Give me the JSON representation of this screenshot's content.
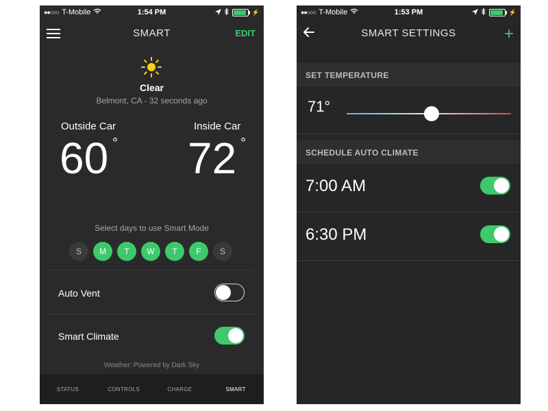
{
  "left": {
    "status": {
      "carrier": "T-Mobile",
      "time": "1:54 PM"
    },
    "nav": {
      "title": "SMART",
      "edit": "EDIT"
    },
    "weather": {
      "condition": "Clear",
      "location": "Belmont, CA - 32 seconds ago",
      "icon": "sun-icon"
    },
    "outside": {
      "label": "Outside Car",
      "value": "60"
    },
    "inside": {
      "label": "Inside Car",
      "value": "72"
    },
    "days_caption": "Select days to use Smart Mode",
    "days": [
      {
        "letter": "S",
        "on": false
      },
      {
        "letter": "M",
        "on": true
      },
      {
        "letter": "T",
        "on": true
      },
      {
        "letter": "W",
        "on": true
      },
      {
        "letter": "T",
        "on": true
      },
      {
        "letter": "F",
        "on": true
      },
      {
        "letter": "S",
        "on": false
      }
    ],
    "auto_vent": {
      "label": "Auto Vent",
      "on": false
    },
    "smart_climate": {
      "label": "Smart Climate",
      "on": true
    },
    "powered_by": "Weather: Powered by Dark Sky",
    "tabs": [
      "STATUS",
      "CONTROLS",
      "CHARGE",
      "SMART"
    ],
    "active_tab": "SMART"
  },
  "right": {
    "status": {
      "carrier": "T-Mobile",
      "time": "1:53 PM"
    },
    "nav": {
      "title": "SMART SETTINGS"
    },
    "set_temperature": {
      "header": "SET TEMPERATURE",
      "value": "71°"
    },
    "schedule": {
      "header": "SCHEDULE AUTO CLIMATE",
      "items": [
        {
          "time": "7:00 AM",
          "on": true
        },
        {
          "time": "6:30 PM",
          "on": true
        }
      ]
    }
  },
  "colors": {
    "accent": "#3ec96b",
    "background": "#2a2a2a",
    "slider_cold": "#5ab4e0",
    "slider_hot": "#e0474c"
  }
}
